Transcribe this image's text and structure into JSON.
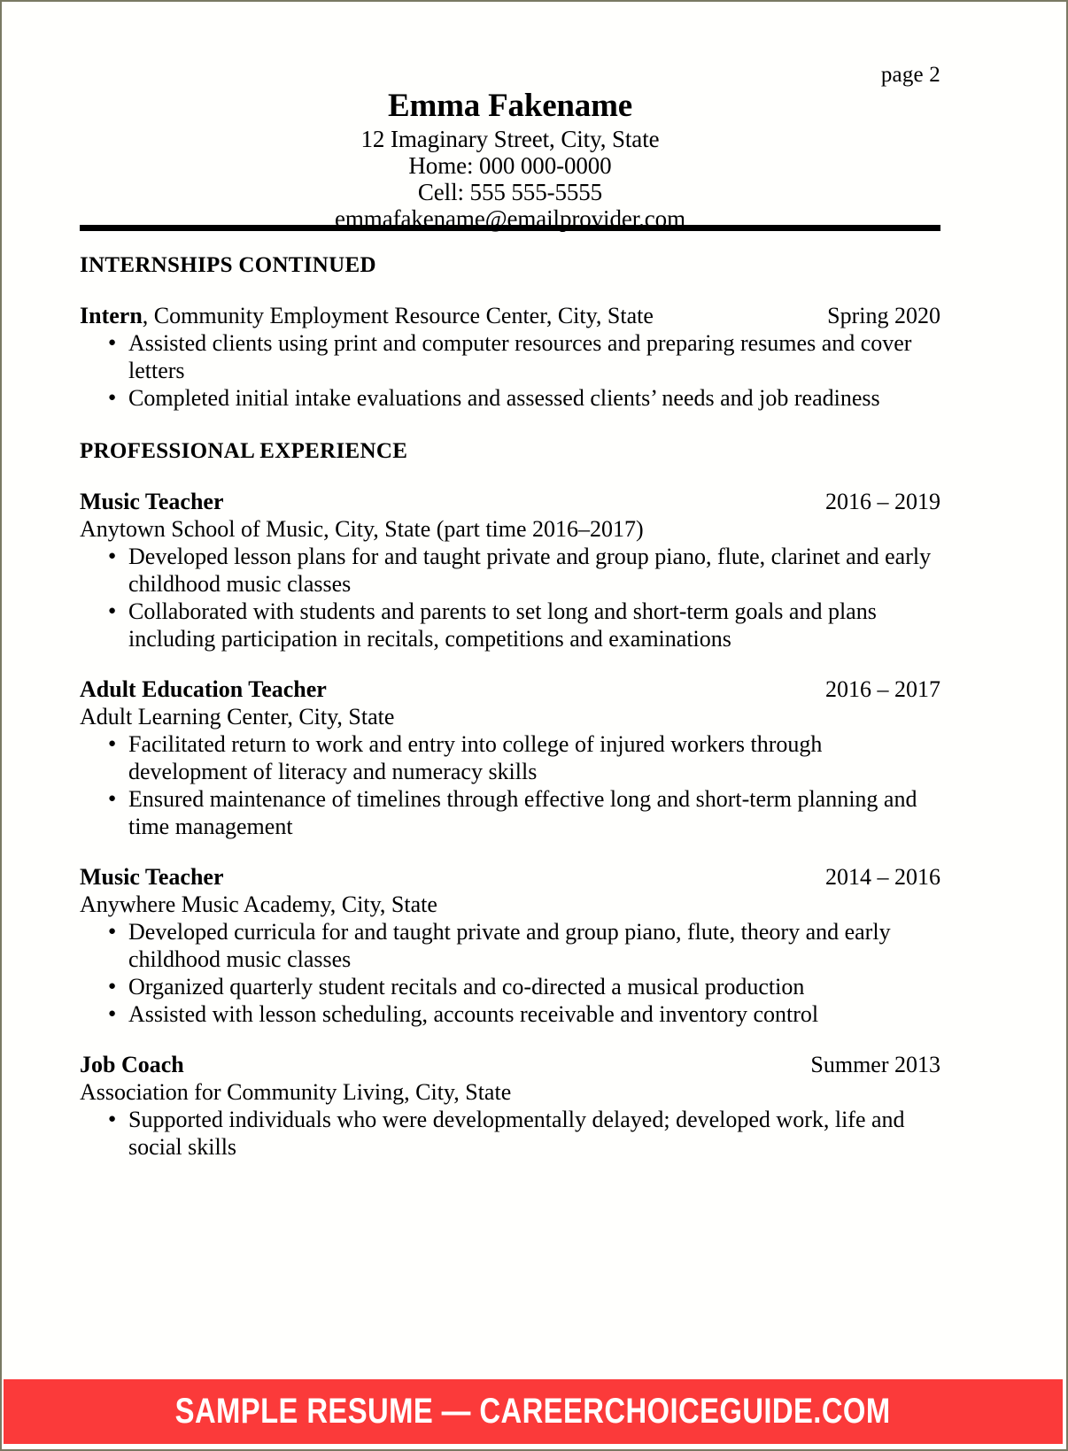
{
  "document": {
    "page_label": "page 2"
  },
  "header": {
    "name": "Emma Fakename",
    "address": "12 Imaginary Street, City, State",
    "home_phone": "Home: 000 000-0000",
    "cell_phone": "Cell: 555 555-5555",
    "email": "emmafakename@emailprovider.com"
  },
  "sections": [
    {
      "heading": "INTERNSHIPS CONTINUED",
      "entries": [
        {
          "title_bold": "Intern",
          "title_rest": ", Community Employment Resource Center, City, State",
          "date": "Spring 2020",
          "org": "",
          "bullets": [
            "Assisted clients using print and computer resources and preparing resumes and cover letters",
            "Completed initial intake evaluations and assessed clients’ needs and job readiness"
          ]
        }
      ]
    },
    {
      "heading": "PROFESSIONAL EXPERIENCE",
      "entries": [
        {
          "title_bold": "Music Teacher",
          "title_rest": "",
          "date": "2016 – 2019",
          "org": "Anytown School of Music, City, State (part time 2016–2017)",
          "bullets": [
            "Developed lesson plans for and taught private and group piano, flute, clarinet and early childhood music classes",
            "Collaborated with students and parents to set long and short-term goals and plans including participation in recitals, competitions and examinations"
          ]
        },
        {
          "title_bold": "Adult Education Teacher",
          "title_rest": "",
          "date": "2016 – 2017",
          "org": "Adult Learning Center, City, State",
          "bullets": [
            "Facilitated return to work and entry into college of injured workers through development of literacy and numeracy skills",
            "Ensured maintenance of timelines through effective long and short-term planning and time management"
          ]
        },
        {
          "title_bold": "Music Teacher",
          "title_rest": "",
          "date": "2014 – 2016",
          "org": "Anywhere Music Academy, City, State",
          "bullets": [
            "Developed curricula for and taught private and group piano, flute, theory and early childhood music classes",
            "Organized quarterly student recitals and co-directed a musical production",
            "Assisted with lesson scheduling, accounts receivable and inventory control"
          ]
        },
        {
          "title_bold": "Job Coach",
          "title_rest": "",
          "date": "Summer 2013",
          "org": "Association for Community Living, City, State",
          "bullets": [
            "Supported individuals who were developmentally delayed; developed work, life and social skills"
          ]
        }
      ]
    }
  ],
  "footer": {
    "banner_text": "SAMPLE RESUME — CAREERCHOICEGUIDE.COM",
    "banner_color": "#fb3a3a",
    "banner_text_color": "#ffffff"
  }
}
